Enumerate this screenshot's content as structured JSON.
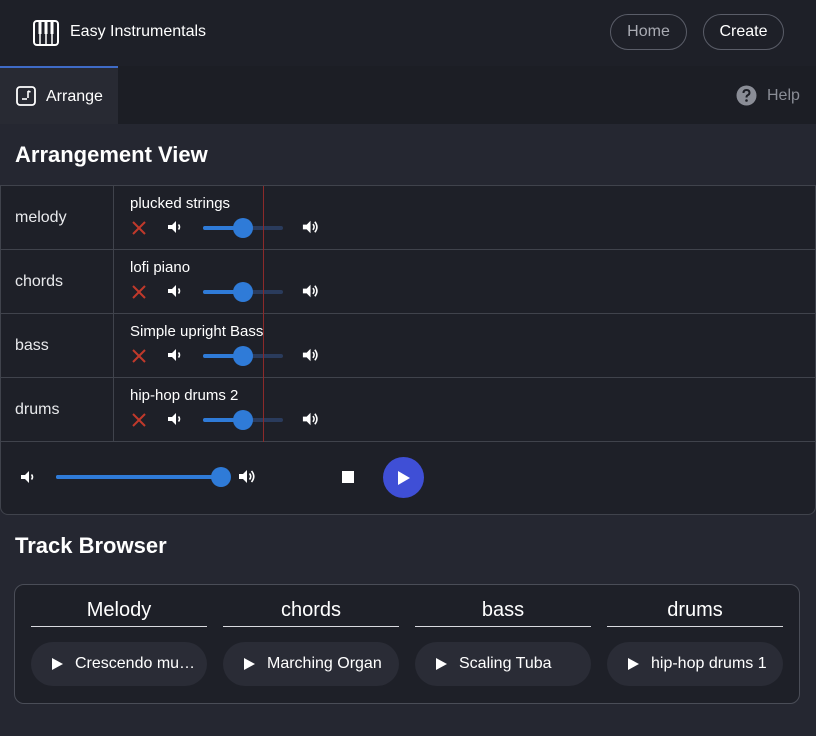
{
  "header": {
    "app_title": "Easy Instrumentals",
    "home_label": "Home",
    "create_label": "Create"
  },
  "tabs": {
    "arrange_label": "Arrange",
    "help_label": "Help"
  },
  "arrangement": {
    "title": "Arrangement View",
    "tracks": [
      {
        "name": "melody",
        "clip": "plucked strings",
        "volume": 0.5
      },
      {
        "name": "chords",
        "clip": "lofi piano",
        "volume": 0.5
      },
      {
        "name": "bass",
        "clip": "Simple upright Bass",
        "volume": 0.5
      },
      {
        "name": "drums",
        "clip": "hip-hop drums 2",
        "volume": 0.5
      }
    ],
    "master_volume": 1.0
  },
  "browser": {
    "title": "Track Browser",
    "columns": [
      {
        "header": "Melody",
        "item": "Crescendo music box"
      },
      {
        "header": "chords",
        "item": "Marching Organ"
      },
      {
        "header": "bass",
        "item": "Scaling Tuba"
      },
      {
        "header": "drums",
        "item": "hip-hop drums 1"
      }
    ]
  },
  "colors": {
    "accent": "#2f7bd8",
    "play_button": "#3f4fd6",
    "remove": "#c0392b",
    "background": "#252731"
  },
  "icons": {
    "logo": "piano-keys-icon",
    "arrange_tab": "music-note-icon",
    "help": "question-circle-icon"
  }
}
